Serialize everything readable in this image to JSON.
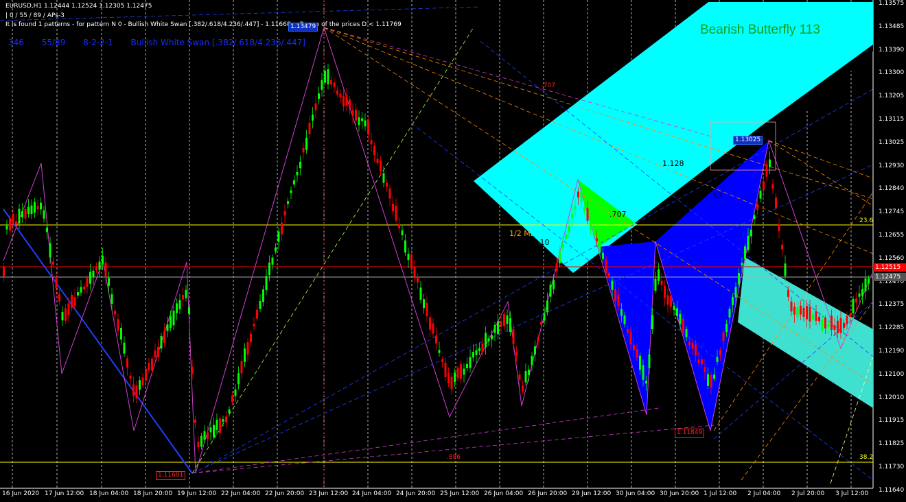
{
  "header": {
    "line1": "EURUSD,H1  1.12444 1.12524 1.12305 1.12475",
    "line2": " | 0 / 55 / 89 / APs-3",
    "line3": "It is found 1 patterns  -  for pattern N 0 - Bullish White Swan [.382/.618/4.236/.447] - 1.11668 < Range of the prices D < 1.11769"
  },
  "pattern_info": {
    "a": "346",
    "b": "55/89",
    "c": "8-2-2-1",
    "d": "Bullish White Swan [.382/.618/4.236/.447]"
  },
  "pattern_title": "Bearish Butterfly 113",
  "price_axis": [
    "1.13575",
    "1.13485",
    "1.13390",
    "1.13300",
    "1.13205",
    "1.13115",
    "1.13025",
    "1.12930",
    "1.12840",
    "1.12745",
    "1.12655",
    "1.12560",
    "1.12470",
    "1.12375",
    "1.12285",
    "1.12190",
    "1.12100",
    "1.12010",
    "1.11915",
    "1.11825",
    "1.11730",
    "1.11640"
  ],
  "time_axis": [
    "16 Jun 2020",
    "17 Jun 12:00",
    "18 Jun 04:00",
    "18 Jun 20:00",
    "19 Jun 12:00",
    "22 Jun 04:00",
    "22 Jun 20:00",
    "23 Jun 12:00",
    "24 Jun 04:00",
    "24 Jun 20:00",
    "25 Jun 12:00",
    "26 Jun 04:00",
    "26 Jun 20:00",
    "29 Jun 12:00",
    "30 Jun 04:00",
    "30 Jun 20:00",
    "1 Jul 12:00",
    "2 Jul 04:00",
    "2 Jul 20:00",
    "3 Jul 12:00"
  ],
  "price_tags": {
    "red": "1.12515",
    "grey": "1.12475"
  },
  "box_labels": {
    "low_left": "1.11681",
    "top_mid": "1.13479",
    "low_right": "1.11849",
    "top_right": "1.13025"
  },
  "annotations": {
    "a1": "1.128",
    "a2": ".707",
    "a3": "2.10",
    "a4": "1/2 ML",
    "a5": ".53",
    "a6": "23.6",
    "a7": "38.2",
    "a8": ".886",
    "a9": ".707"
  },
  "colors": {
    "bull": "#00ff00",
    "bear": "#ff0000",
    "cyan": "#00ffff",
    "blue": "#0000ff",
    "teal": "#40e0d0"
  }
}
